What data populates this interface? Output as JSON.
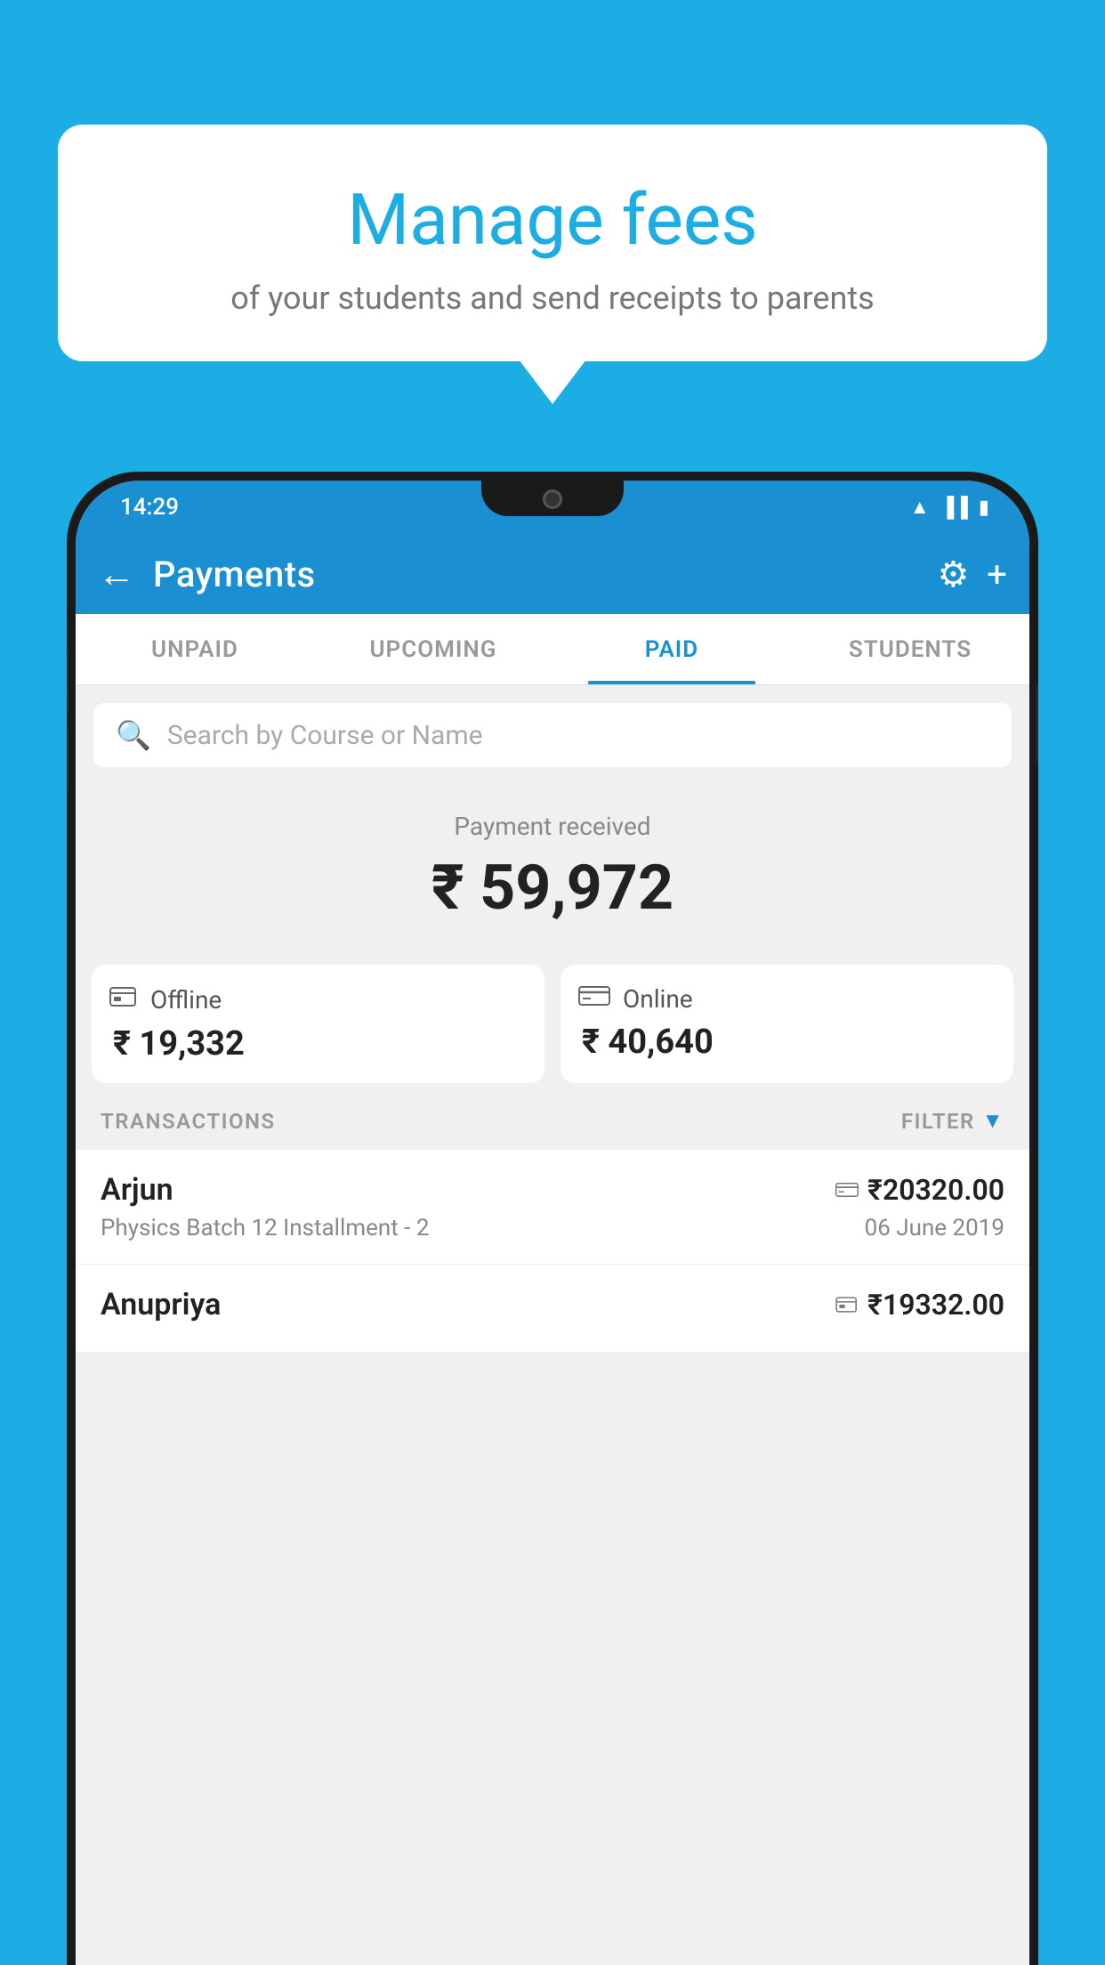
{
  "background_color": "#1BADE4",
  "bubble": {
    "title": "Manage fees",
    "subtitle": "of your students and send receipts to parents"
  },
  "status_bar": {
    "time": "14:29",
    "icons": [
      "wifi",
      "signal",
      "battery"
    ]
  },
  "app_bar": {
    "title": "Payments",
    "back_label": "←",
    "gear_label": "⚙",
    "plus_label": "+"
  },
  "tabs": [
    {
      "label": "UNPAID",
      "active": false
    },
    {
      "label": "UPCOMING",
      "active": false
    },
    {
      "label": "PAID",
      "active": true
    },
    {
      "label": "STUDENTS",
      "active": false
    }
  ],
  "search": {
    "placeholder": "Search by Course or Name"
  },
  "payment_summary": {
    "label": "Payment received",
    "amount": "₹ 59,972",
    "cards": [
      {
        "icon": "offline",
        "label": "Offline",
        "amount": "₹ 19,332"
      },
      {
        "icon": "online",
        "label": "Online",
        "amount": "₹ 40,640"
      }
    ]
  },
  "transactions": {
    "header_label": "TRANSACTIONS",
    "filter_label": "FILTER",
    "rows": [
      {
        "name": "Arjun",
        "amount": "₹20320.00",
        "detail": "Physics Batch 12 Installment - 2",
        "date": "06 June 2019",
        "payment_type": "online"
      },
      {
        "name": "Anupriya",
        "amount": "₹19332.00",
        "detail": "",
        "date": "",
        "payment_type": "offline"
      }
    ]
  }
}
